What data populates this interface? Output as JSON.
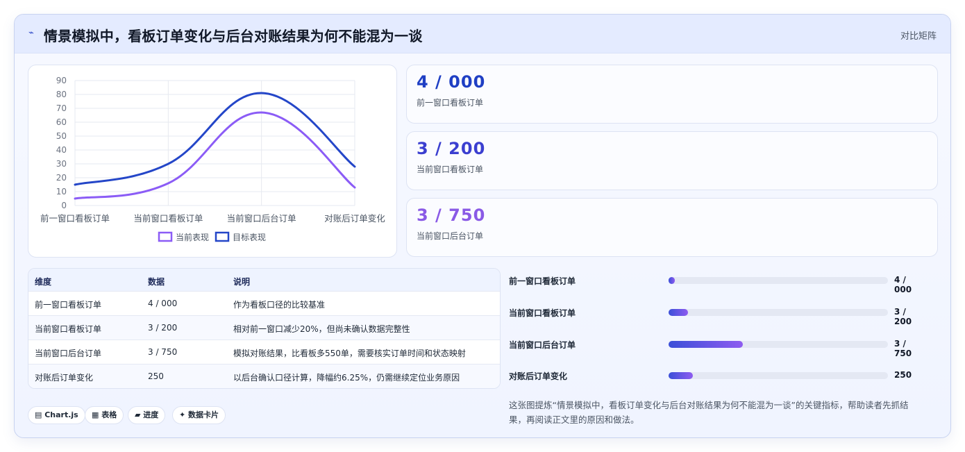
{
  "header": {
    "title": "情景模拟中，看板订单变化与后台对账结果为何不能混为一谈",
    "tag": "对比矩阵"
  },
  "chart_data": {
    "type": "line",
    "categories": [
      "前一窗口看板订单",
      "当前窗口看板订单",
      "当前窗口后台订单",
      "对账后订单变化"
    ],
    "series": [
      {
        "name": "当前表现",
        "values": [
          5,
          16,
          67,
          13
        ],
        "color": "#8b5cf6"
      },
      {
        "name": "目标表现",
        "values": [
          15,
          30,
          81,
          28
        ],
        "color": "#2446c8"
      }
    ],
    "ylim": [
      0,
      90
    ],
    "yticks": [
      0,
      10,
      20,
      30,
      40,
      50,
      60,
      70,
      80,
      90
    ],
    "grid": true,
    "legend": "bottom",
    "xlabel": "",
    "ylabel": ""
  },
  "kpis": [
    {
      "value": "4 / 000",
      "label": "前一窗口看板订单",
      "color": "#1f3fc4"
    },
    {
      "value": "3 / 200",
      "label": "当前窗口看板订单",
      "color": "#3b3fd0"
    },
    {
      "value": "3 / 750",
      "label": "当前窗口后台订单",
      "color": "#8a5ae6"
    }
  ],
  "table": {
    "headers": [
      "维度",
      "数据",
      "说明"
    ],
    "rows": [
      [
        "前一窗口看板订单",
        "4 / 000",
        "作为看板口径的比较基准"
      ],
      [
        "当前窗口看板订单",
        "3 / 200",
        "相对前一窗口减少20%，但尚未确认数据完整性"
      ],
      [
        "当前窗口后台订单",
        "3 / 750",
        "模拟对账结果，比看板多550单，需要核实订单时间和状态映射"
      ],
      [
        "对账后订单变化",
        "250",
        "以后台确认口径计算，降幅约6.25%，仍需继续定位业务原因"
      ]
    ]
  },
  "progress": [
    {
      "label": "前一窗口看板订单",
      "value_text": "4 / 000",
      "fraction": 0.03
    },
    {
      "label": "当前窗口看板订单",
      "value_text": "3 / 200",
      "fraction": 0.09
    },
    {
      "label": "当前窗口后台订单",
      "value_text": "3 / 750",
      "fraction": 0.34
    },
    {
      "label": "对账后订单变化",
      "value_text": "250",
      "fraction": 0.11
    }
  ],
  "chips": [
    "▤ Chart.js",
    "▦ 表格",
    "▰ 进度",
    "✦ 数据卡片"
  ],
  "note": "这张图提炼“情景模拟中，看板订单变化与后台对账结果为何不能混为一谈”的关键指标，帮助读者先抓结果，再阅读正文里的原因和做法。"
}
